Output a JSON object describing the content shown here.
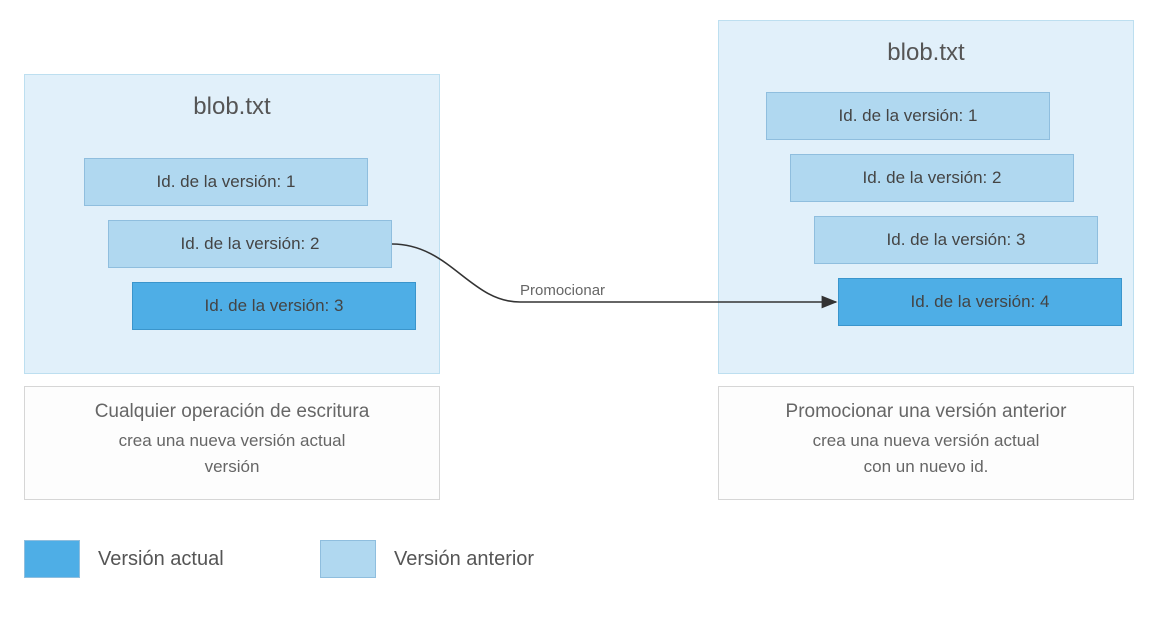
{
  "left": {
    "title": "blob.txt",
    "versions": [
      {
        "label": "Id. de la versión: 1",
        "type": "previous"
      },
      {
        "label": "Id. de la versión: 2",
        "type": "previous"
      },
      {
        "label": "Id. de la versión: 3",
        "type": "current"
      }
    ],
    "caption": {
      "line1": "Cualquier operación de escritura",
      "line2": "crea una nueva versión actual",
      "line3": "versión"
    }
  },
  "right": {
    "title": "blob.txt",
    "versions": [
      {
        "label": "Id. de la versión: 1",
        "type": "previous"
      },
      {
        "label": "Id. de la versión: 2",
        "type": "previous"
      },
      {
        "label": "Id. de la versión: 3",
        "type": "previous"
      },
      {
        "label": "Id. de la versión: 4",
        "type": "current"
      }
    ],
    "caption": {
      "line1": "Promocionar una versión anterior",
      "line2": "crea una nueva versión actual",
      "line3": "con un nuevo id."
    }
  },
  "arrow_label": "Promocionar",
  "legend": {
    "current": "Versión actual",
    "previous": "Versión anterior"
  },
  "colors": {
    "panel_bg": "#e1f0fa",
    "previous_bg": "#b0d8f0",
    "current_bg": "#4eaee6"
  }
}
